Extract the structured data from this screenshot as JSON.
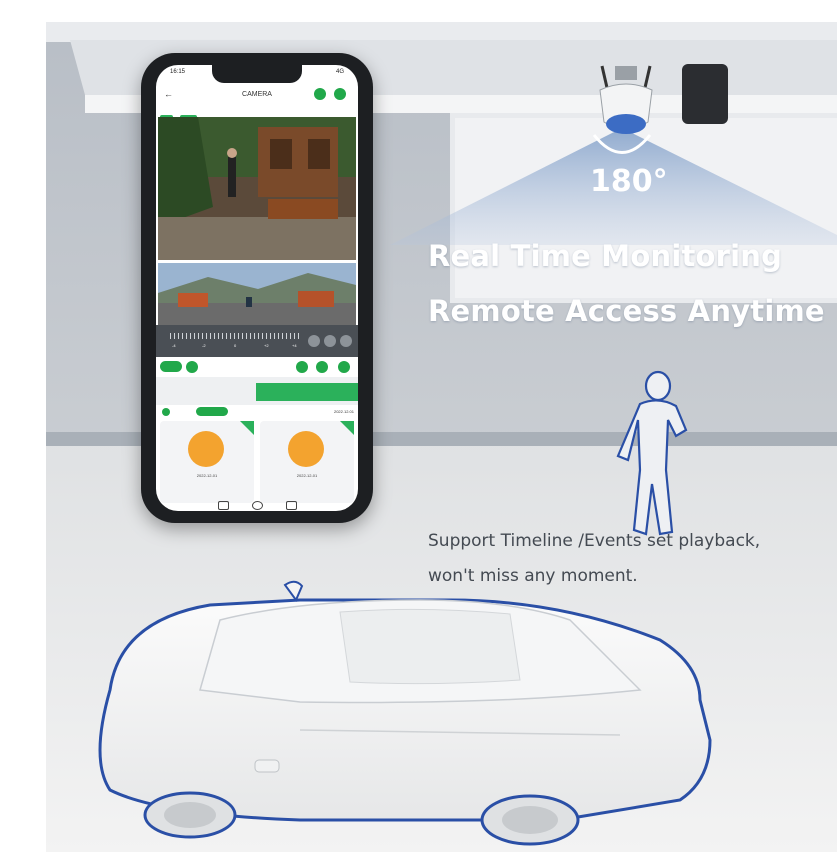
{
  "headline": {
    "line1": "Real Time Monitoring",
    "line2": "Remote Access Anytime"
  },
  "coverage_angle": "180°",
  "caption": {
    "line1": "Support Timeline /Events set playback,",
    "line2": "won't miss any moment."
  },
  "phone": {
    "status_time": "16:15",
    "status_right": "4G",
    "nav_title": "CAMERA",
    "tags": [
      "Live",
      "Online"
    ],
    "timeline_ticks": [
      "-4",
      "-2",
      "0",
      "+2",
      "+4"
    ],
    "event_row_right": "2022.12.01",
    "event_card_time": "2022-12-01",
    "colors": {
      "accent": "#21a84a",
      "event": "#f3a32f"
    }
  },
  "colors": {
    "wall": "#c4c9cf",
    "floor": "#e8e9ea",
    "beam": "#8ba6c9",
    "outline": "#2a4fa6"
  }
}
